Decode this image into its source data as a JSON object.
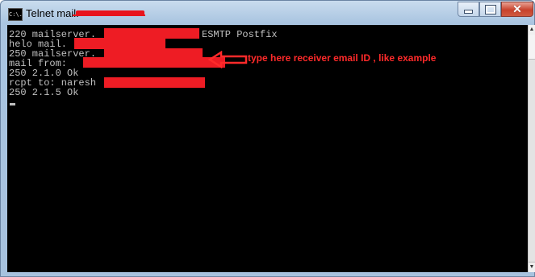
{
  "window": {
    "title": "Telnet mail.",
    "app_icon_text": "C:\\.",
    "controls": {
      "minimize_icon": "minimize-icon",
      "maximize_icon": "maximize-icon",
      "close_icon": "close-icon",
      "close_glyph": "✕"
    }
  },
  "console": {
    "lines": [
      "220 mailserver.",
      "helo mail.",
      "250 mailserver.",
      "mail from: ",
      "250 2.1.0 Ok",
      "rcpt to: naresh",
      "250 2.1.5 Ok"
    ],
    "line0_suffix": "ESMTP Postfix"
  },
  "annotation": {
    "text": "type here receiver email ID , like example",
    "color": "#ff2a2a"
  },
  "colors": {
    "console_bg": "#000000",
    "console_text": "#c0c0c0",
    "redaction": "#ee1c24",
    "close_button": "#c8422c"
  },
  "scrollbar": {
    "up_glyph": "▲",
    "down_glyph": "▼"
  }
}
